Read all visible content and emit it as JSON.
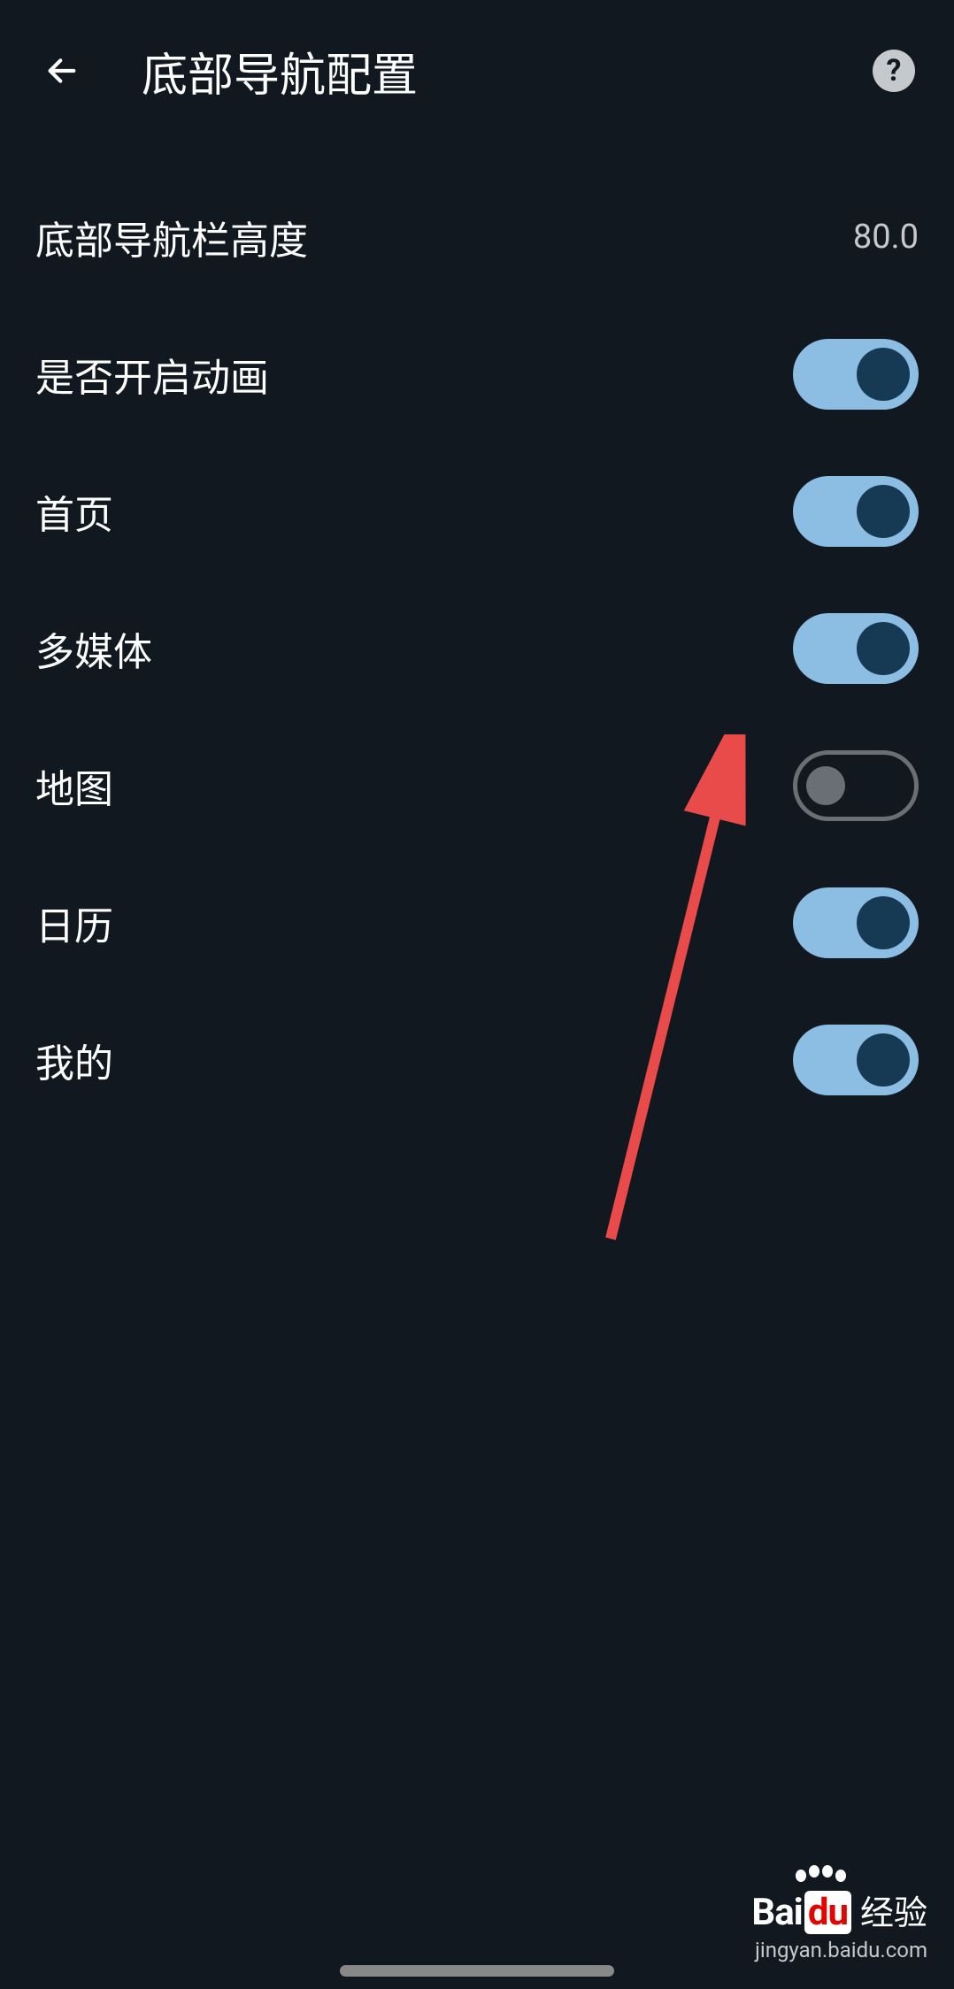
{
  "header": {
    "title": "底部导航配置"
  },
  "settings": {
    "height": {
      "label": "底部导航栏高度",
      "value": "80.0"
    },
    "animation": {
      "label": "是否开启动画",
      "enabled": true
    },
    "home": {
      "label": "首页",
      "enabled": true
    },
    "multimedia": {
      "label": "多媒体",
      "enabled": true
    },
    "map": {
      "label": "地图",
      "enabled": false
    },
    "calendar": {
      "label": "日历",
      "enabled": true
    },
    "mine": {
      "label": "我的",
      "enabled": true
    }
  },
  "watermark": {
    "logo_main": "Bai",
    "logo_du": "du",
    "logo_suffix": "经验",
    "url": "jingyan.baidu.com"
  }
}
